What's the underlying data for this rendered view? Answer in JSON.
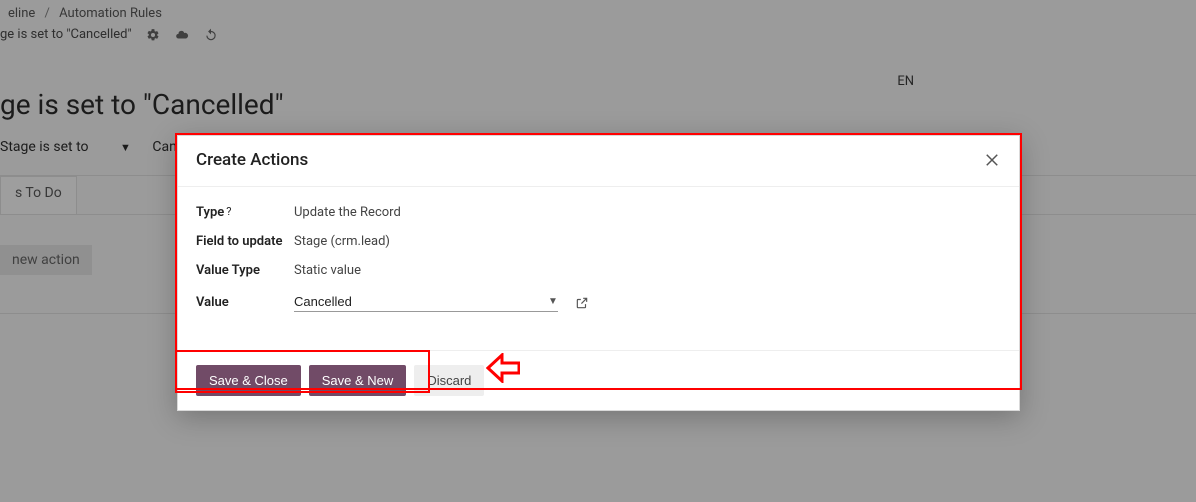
{
  "breadcrumb": {
    "item1": "eline",
    "item2": "Automation Rules"
  },
  "subline": {
    "text": "ge is set to \"Cancelled\""
  },
  "lang_badge": "EN",
  "page": {
    "title": "ge is set to \"Cancelled\"",
    "cfg_label": "Stage is set to",
    "cfg_value": "Cancelled",
    "tab_label": "s To Do",
    "new_action_btn": "new action"
  },
  "modal": {
    "title": "Create Actions",
    "rows": {
      "type_label": "Type",
      "type_q": "?",
      "type_value": "Update the Record",
      "field_label": "Field to update",
      "field_value": "Stage (crm.lead)",
      "valuetype_label": "Value Type",
      "valuetype_value": "Static value",
      "value_label": "Value",
      "value_value": "Cancelled"
    },
    "buttons": {
      "save_close": "Save & Close",
      "save_new": "Save & New",
      "discard": "Discard"
    }
  }
}
